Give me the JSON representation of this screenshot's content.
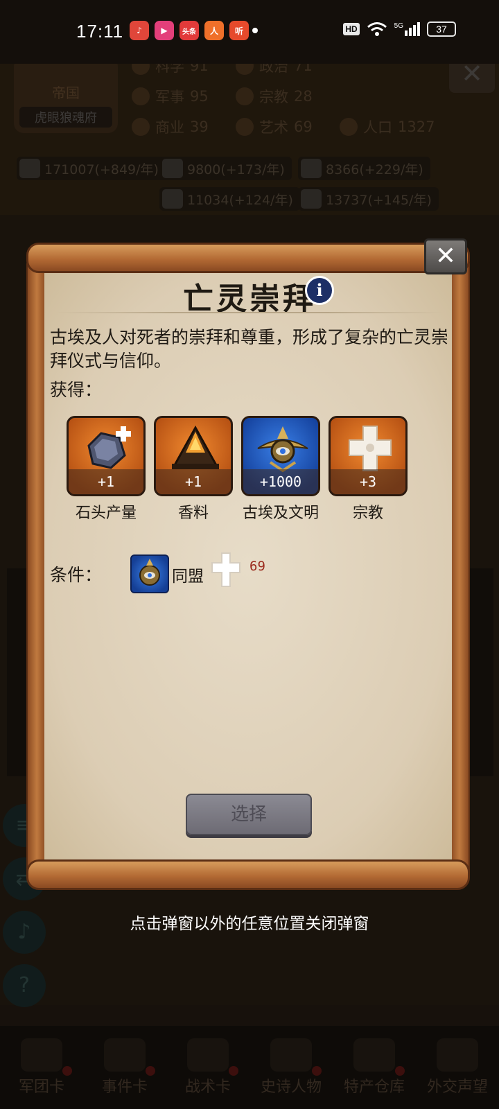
{
  "status_bar": {
    "time": "17:11",
    "apps": [
      {
        "name": "music-app-icon",
        "color": "#e0463a",
        "glyph": "♪"
      },
      {
        "name": "video-app-icon",
        "color": "#e33f7a",
        "glyph": "▶"
      },
      {
        "name": "news-app-icon",
        "color": "#e23a3a",
        "glyph": "头条"
      },
      {
        "name": "people-app-icon",
        "color": "#f0702a",
        "glyph": "人"
      },
      {
        "name": "listen-app-icon",
        "color": "#e64a2c",
        "glyph": "听"
      }
    ],
    "hd": "HD",
    "network": "5G",
    "battery": "37"
  },
  "background": {
    "emblem_title": "帝国",
    "emblem_name": "虎眼狼魂府",
    "stats": [
      {
        "label": "科学",
        "value": "91"
      },
      {
        "label": "政治",
        "value": "71"
      },
      {
        "label": "军事",
        "value": "95"
      },
      {
        "label": "宗教",
        "value": "28"
      },
      {
        "label": "商业",
        "value": "39"
      },
      {
        "label": "艺术",
        "value": "69"
      },
      {
        "label": "人口",
        "value": "1327"
      }
    ],
    "resources": [
      "171007(+849/年)",
      "9800(+173/年)",
      "8366(+229/年)",
      "11034(+124/年)",
      "13737(+145/年)"
    ],
    "bottom_tabs": [
      "军团卡",
      "事件卡",
      "战术卡",
      "史诗人物",
      "特产仓库",
      "外交声望"
    ]
  },
  "dialog": {
    "title": "亡灵崇拜",
    "description": "古埃及人对死者的崇拜和尊重，形成了复杂的亡灵崇拜仪式与信仰。",
    "gain_label": "获得：",
    "rewards": [
      {
        "name": "石头产量",
        "amount": "+1",
        "icon": "stone-icon",
        "color": "orange"
      },
      {
        "name": "香料",
        "amount": "+1",
        "icon": "spice-icon",
        "color": "orange"
      },
      {
        "name": "古埃及文明",
        "amount": "+1000",
        "icon": "egypt-civilization-icon",
        "color": "blue"
      },
      {
        "name": "宗教",
        "amount": "+3",
        "icon": "religion-icon",
        "color": "orange"
      }
    ],
    "condition_label": "条件：",
    "condition_text": "同盟",
    "condition_religion_value": "69",
    "select_label": "选择",
    "close_glyph": "✕",
    "info_glyph": "i"
  },
  "dismiss_hint": "点击弹窗以外的任意位置关闭弹窗"
}
